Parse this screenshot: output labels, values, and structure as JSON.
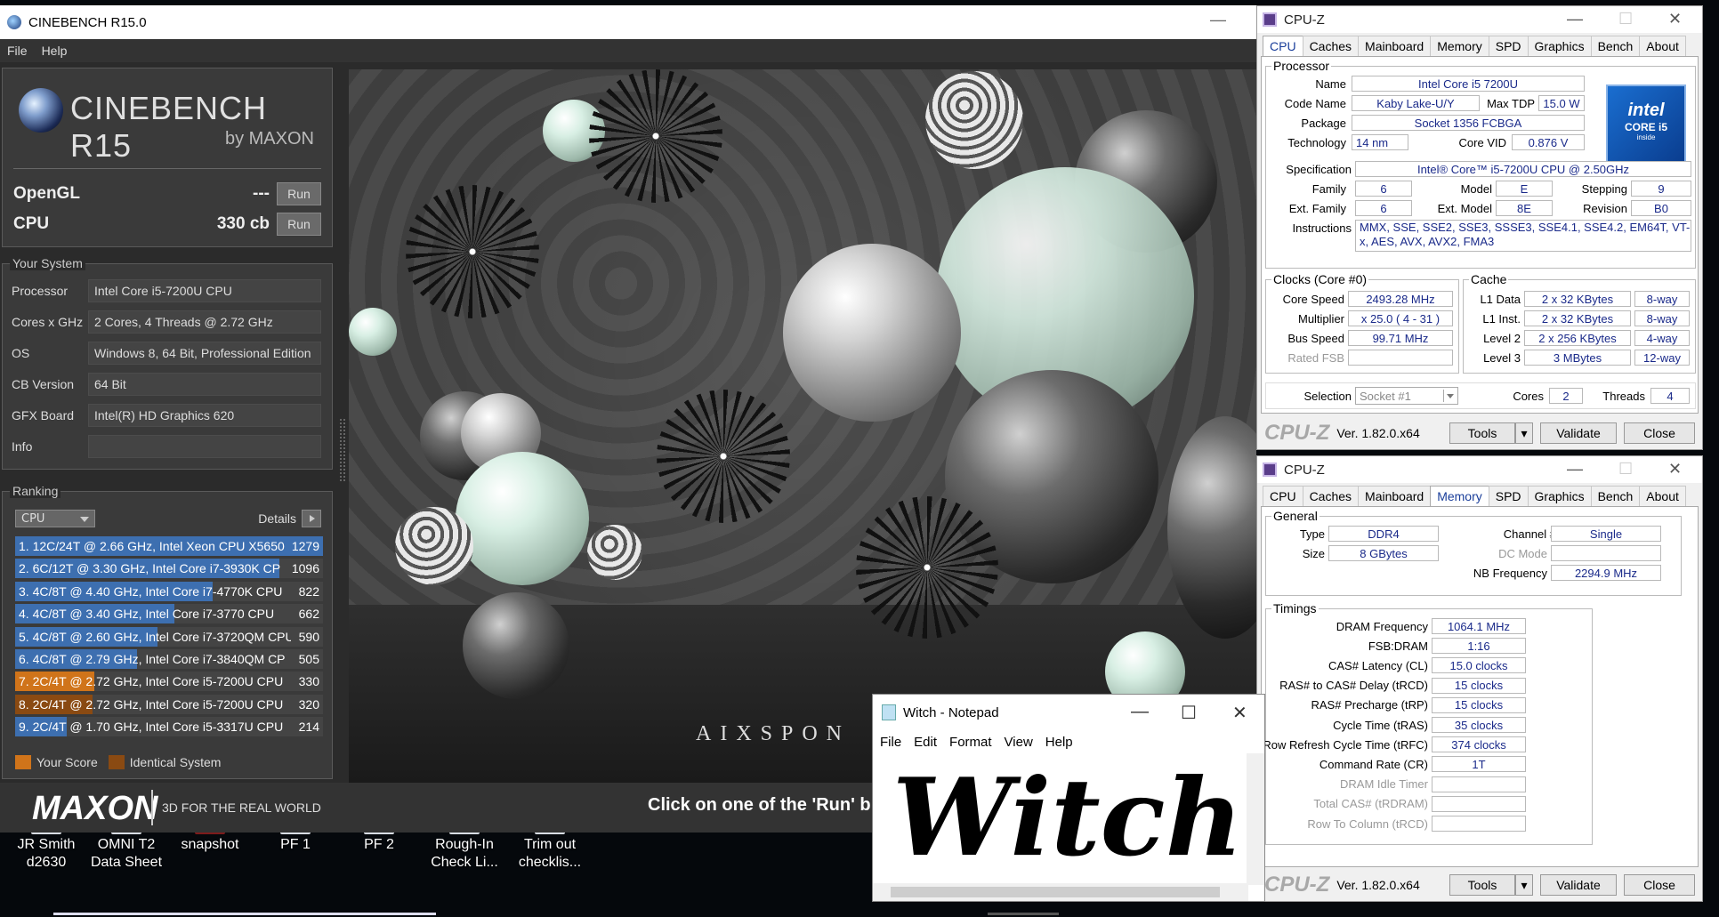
{
  "desktop": {
    "icons": [
      {
        "label1": "JR Smith",
        "label2": "d2630"
      },
      {
        "label1": "OMNI T2",
        "label2": "Data Sheet"
      },
      {
        "label1": "snapshot",
        "label2": ""
      },
      {
        "label1": "PF 1",
        "label2": ""
      },
      {
        "label1": "PF 2",
        "label2": ""
      },
      {
        "label1": "Rough-In",
        "label2": "Check Li..."
      },
      {
        "label1": "Trim out",
        "label2": "checklis..."
      }
    ]
  },
  "cinebench": {
    "window_title": "CINEBENCH R15.0",
    "menu": [
      "File",
      "Help"
    ],
    "logo_title": "CINEBENCH R15",
    "logo_by": "by MAXON",
    "opengl_label": "OpenGL",
    "opengl_value": "---",
    "cpu_label": "CPU",
    "cpu_value": "330 cb",
    "run_label": "Run",
    "your_system_title": "Your System",
    "system": [
      {
        "key": "Processor",
        "value": "Intel Core i5-7200U CPU"
      },
      {
        "key": "Cores x GHz",
        "value": "2 Cores, 4 Threads @ 2.72 GHz"
      },
      {
        "key": "OS",
        "value": "Windows 8, 64 Bit, Professional Edition"
      },
      {
        "key": "CB Version",
        "value": "64 Bit"
      },
      {
        "key": "GFX Board",
        "value": "Intel(R) HD Graphics 620"
      },
      {
        "key": "Info",
        "value": ""
      }
    ],
    "ranking_title": "Ranking",
    "ranking_select": "CPU",
    "details_label": "Details",
    "ranking": [
      {
        "text": "1. 12C/24T @ 2.66 GHz, Intel Xeon CPU X5650",
        "score": "1279",
        "fraction": 1.0,
        "kind": "other"
      },
      {
        "text": "2. 6C/12T @ 3.30 GHz,  Intel Core i7-3930K CP",
        "score": "1096",
        "fraction": 0.857,
        "kind": "other"
      },
      {
        "text": "3. 4C/8T @ 4.40 GHz, Intel Core i7-4770K CPU",
        "score": "822",
        "fraction": 0.643,
        "kind": "other"
      },
      {
        "text": "4. 4C/8T @ 3.40 GHz,  Intel Core i7-3770 CPU",
        "score": "662",
        "fraction": 0.518,
        "kind": "other"
      },
      {
        "text": "5. 4C/8T @ 2.60 GHz, Intel Core i7-3720QM CPU",
        "score": "590",
        "fraction": 0.461,
        "kind": "other"
      },
      {
        "text": "6. 4C/8T @ 2.79 GHz,  Intel Core i7-3840QM CP",
        "score": "505",
        "fraction": 0.395,
        "kind": "other"
      },
      {
        "text": "7. 2C/4T @ 2.72 GHz, Intel Core i5-7200U CPU",
        "score": "330",
        "fraction": 0.258,
        "kind": "your"
      },
      {
        "text": "8. 2C/4T @ 2.72 GHz, Intel Core i5-7200U CPU",
        "score": "320",
        "fraction": 0.25,
        "kind": "identical"
      },
      {
        "text": "9. 2C/4T @ 1.70 GHz,  Intel Core i5-3317U CPU",
        "score": "214",
        "fraction": 0.167,
        "kind": "other"
      }
    ],
    "legend_your": "Your Score",
    "legend_identical": "Identical System",
    "render_watermark": "AIXSPON",
    "maxon": "MAXON",
    "tagline": "3D FOR THE REAL WORLD",
    "hint": "Click on one of the 'Run' b",
    "colors": {
      "bar_other": "#3d6fb0",
      "bar_your": "#d0741a",
      "bar_identical": "#8a4a12"
    }
  },
  "cpuz1": {
    "title": "CPU-Z",
    "tabs": [
      "CPU",
      "Caches",
      "Mainboard",
      "Memory",
      "SPD",
      "Graphics",
      "Bench",
      "About"
    ],
    "active_tab": "CPU",
    "processor_title": "Processor",
    "name_label": "Name",
    "name": "Intel Core i5 7200U",
    "codename_label": "Code Name",
    "codename": "Kaby Lake-U/Y",
    "maxtdp_label": "Max TDP",
    "maxtdp": "15.0 W",
    "package_label": "Package",
    "package": "Socket 1356 FCBGA",
    "technology_label": "Technology",
    "technology": "14 nm",
    "corevid_label": "Core VID",
    "corevid": "0.876 V",
    "spec_label": "Specification",
    "spec": "Intel® Core™ i5-7200U CPU @ 2.50GHz",
    "family_label": "Family",
    "family": "6",
    "model_label": "Model",
    "model": "E",
    "stepping_label": "Stepping",
    "stepping": "9",
    "extfamily_label": "Ext. Family",
    "extfamily": "6",
    "extmodel_label": "Ext. Model",
    "extmodel": "8E",
    "revision_label": "Revision",
    "revision": "B0",
    "instructions_label": "Instructions",
    "instructions": "MMX, SSE, SSE2, SSE3, SSSE3, SSE4.1, SSE4.2, EM64T, VT-x, AES, AVX, AVX2, FMA3",
    "intel_logo": {
      "l1": "intel",
      "l2": "CORE i5",
      "l3": "inside"
    },
    "clocks_title": "Clocks (Core #0)",
    "corespeed_label": "Core Speed",
    "corespeed": "2493.28 MHz",
    "multiplier_label": "Multiplier",
    "multiplier": "x 25.0 ( 4 - 31 )",
    "busspeed_label": "Bus Speed",
    "busspeed": "99.71 MHz",
    "ratedfsb_label": "Rated FSB",
    "ratedfsb": "",
    "cache_title": "Cache",
    "l1d_label": "L1 Data",
    "l1d": "2 x 32 KBytes",
    "l1d_way": "8-way",
    "l1i_label": "L1 Inst.",
    "l1i": "2 x 32 KBytes",
    "l1i_way": "8-way",
    "l2_label": "Level 2",
    "l2": "2 x 256 KBytes",
    "l2_way": "4-way",
    "l3_label": "Level 3",
    "l3": "3 MBytes",
    "l3_way": "12-way",
    "selection_label": "Selection",
    "selection": "Socket #1",
    "cores_label": "Cores",
    "cores": "2",
    "threads_label": "Threads",
    "threads": "4",
    "brand": "CPU-Z",
    "version": "Ver. 1.82.0.x64",
    "tools": "Tools",
    "validate": "Validate",
    "close": "Close"
  },
  "cpuz2": {
    "title": "CPU-Z",
    "tabs": [
      "CPU",
      "Caches",
      "Mainboard",
      "Memory",
      "SPD",
      "Graphics",
      "Bench",
      "About"
    ],
    "active_tab": "Memory",
    "general_title": "General",
    "type_label": "Type",
    "type": "DDR4",
    "channel_label": "Channel #",
    "channel": "Single",
    "size_label": "Size",
    "size": "8 GBytes",
    "dcmode_label": "DC Mode",
    "dcmode": "",
    "nbfreq_label": "NB Frequency",
    "nbfreq": "2294.9 MHz",
    "timings_title": "Timings",
    "timings": [
      {
        "label": "DRAM Frequency",
        "value": "1064.1 MHz",
        "dim": false
      },
      {
        "label": "FSB:DRAM",
        "value": "1:16",
        "dim": false
      },
      {
        "label": "CAS# Latency (CL)",
        "value": "15.0 clocks",
        "dim": false
      },
      {
        "label": "RAS# to CAS# Delay (tRCD)",
        "value": "15 clocks",
        "dim": false
      },
      {
        "label": "RAS# Precharge (tRP)",
        "value": "15 clocks",
        "dim": false
      },
      {
        "label": "Cycle Time (tRAS)",
        "value": "35 clocks",
        "dim": false
      },
      {
        "label": "Row Refresh Cycle Time (tRFC)",
        "value": "374 clocks",
        "dim": false
      },
      {
        "label": "Command Rate (CR)",
        "value": "1T",
        "dim": false
      },
      {
        "label": "DRAM Idle Timer",
        "value": "",
        "dim": true
      },
      {
        "label": "Total CAS# (tRDRAM)",
        "value": "",
        "dim": true
      },
      {
        "label": "Row To Column (tRCD)",
        "value": "",
        "dim": true
      }
    ],
    "brand": "CPU-Z",
    "version": "Ver. 1.82.0.x64",
    "tools": "Tools",
    "validate": "Validate",
    "close": "Close"
  },
  "notepad": {
    "title": "Witch - Notepad",
    "menu": [
      "File",
      "Edit",
      "Format",
      "View",
      "Help"
    ],
    "content": "Witch"
  }
}
